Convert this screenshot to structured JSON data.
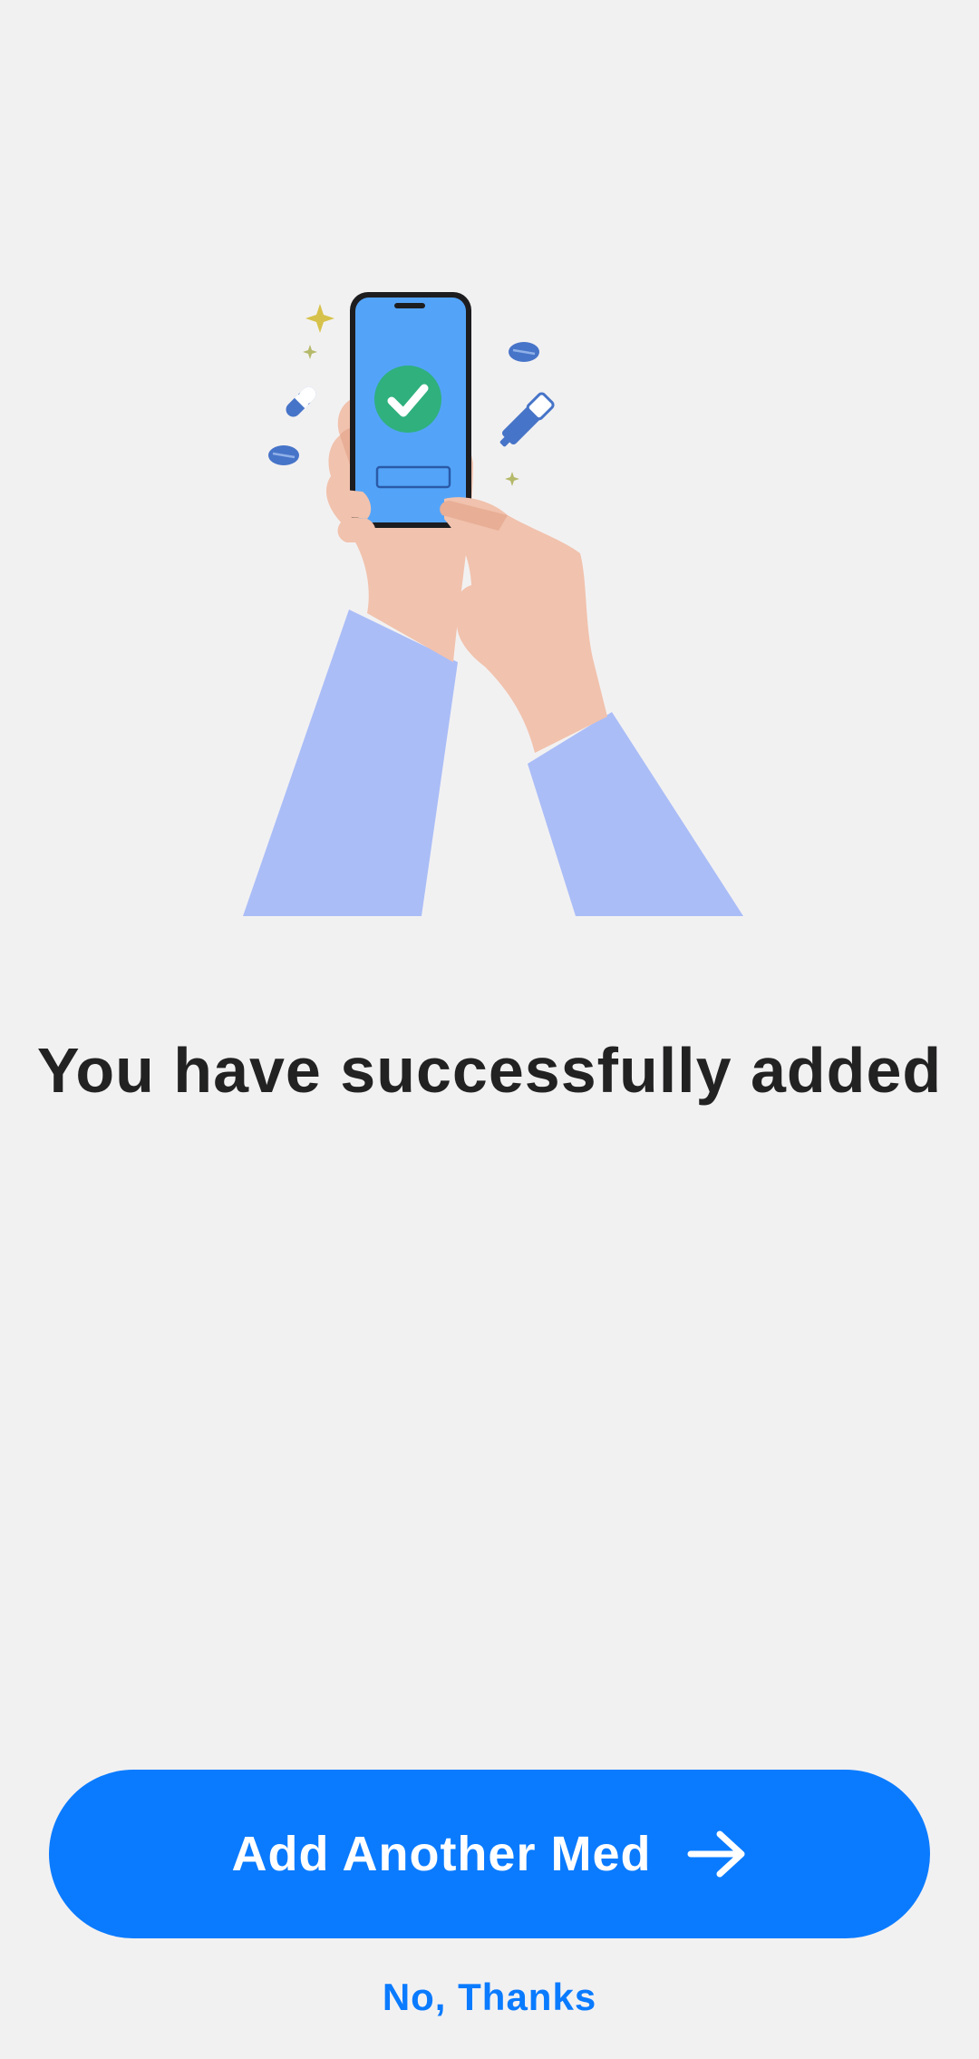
{
  "screen": {
    "headline": "You have successfully added"
  },
  "illustration": {
    "icon": "hand-holding-phone-check-illustration"
  },
  "actions": {
    "primary_label": "Add Another Med",
    "primary_icon": "arrow-right-icon",
    "secondary_label": "No, Thanks"
  },
  "colors": {
    "background": "#f2f1f2",
    "accent": "#0a7bff",
    "text": "#222222",
    "sleeve": "#aabdf7",
    "skin": "#f1c2ad",
    "phone_screen": "#53a4f9",
    "check": "#2fb07d"
  }
}
